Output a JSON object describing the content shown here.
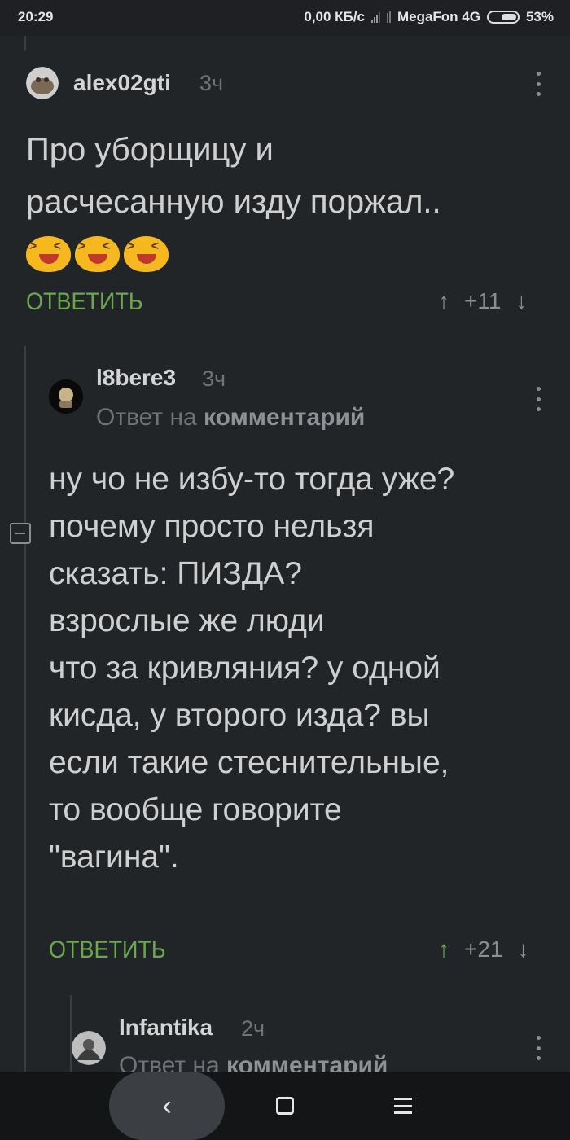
{
  "status_bar": {
    "time": "20:29",
    "speed": "0,00 КБ/с",
    "carrier": "MegaFon 4G",
    "battery": "53%"
  },
  "comments": [
    {
      "username": "alex02gti",
      "time_ago": "3ч",
      "text_lines": [
        "Про уборщицу и",
        "расчесанную изду поржал.."
      ],
      "emoji_count": 3,
      "reply_label": "ОТВЕТИТЬ",
      "votes": "+11",
      "up_arrow": "↑",
      "down_arrow": "↓"
    },
    {
      "username": "l8bere3",
      "time_ago": "3ч",
      "reply_to_prefix": "Ответ на",
      "reply_to_target": "комментарий",
      "text_lines": [
        "ну чо не избу-то тогда уже?",
        "почему просто нельзя",
        "сказать: ПИЗДА?",
        "взрослые же люди",
        "что за кривляния? у одной",
        "кисда, у второго изда? вы",
        "если такие стеснительные,",
        "то вообще говорите",
        "\"вагина\"."
      ],
      "reply_label": "ОТВЕТИТЬ",
      "votes": "+21",
      "up_arrow": "↑",
      "down_arrow": "↓"
    },
    {
      "username": "Infantika",
      "time_ago": "2ч",
      "reply_to_prefix": "Ответ на",
      "reply_to_target": "комментарий"
    }
  ],
  "nav": {
    "back": "‹"
  },
  "colors": {
    "background": "#222528",
    "accent_green": "#6aa84f",
    "muted": "#6f7377"
  }
}
